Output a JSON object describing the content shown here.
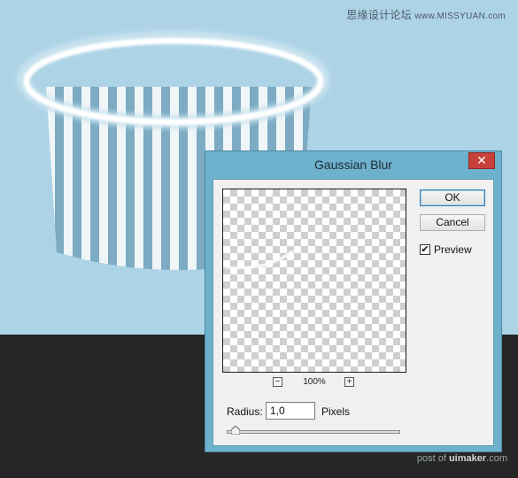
{
  "watermark": {
    "top_cn": "思缘设计论坛",
    "top_en": "www.MISSYUAN.com",
    "bottom_prefix": "post of",
    "bottom_brand": "uimaker",
    "bottom_suffix": ".com"
  },
  "dialog": {
    "title": "Gaussian Blur",
    "close_symbol": "✕",
    "ok_label": "OK",
    "cancel_label": "Cancel",
    "preview_label": "Preview",
    "preview_checked_symbol": "✔",
    "preview_checked": true,
    "zoom_minus": "−",
    "zoom_plus": "+",
    "zoom_value": "100%",
    "radius_label": "Radius:",
    "radius_value": "1,0",
    "pixels_label": "Pixels",
    "radius_slider_fraction": 0.03
  },
  "colors": {
    "background": "#add3e6",
    "dark_band": "#262626",
    "dialog_frame": "#6db1cc",
    "close_button": "#c7413a",
    "stripe_blue": "#6aa0bb",
    "stripe_white": "#eef4f8"
  }
}
